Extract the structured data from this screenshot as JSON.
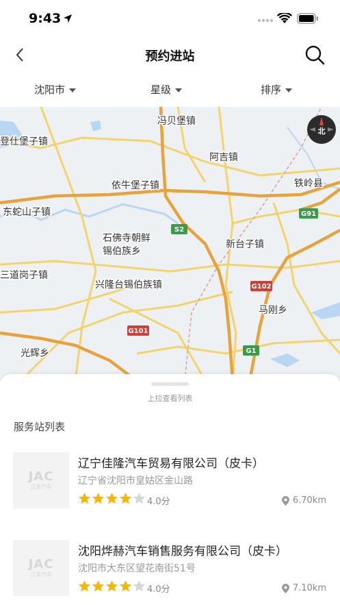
{
  "status_bar": {
    "time": "9:43"
  },
  "nav": {
    "title": "预约进站"
  },
  "filters": [
    {
      "label": "沈阳市"
    },
    {
      "label": "星级"
    },
    {
      "label": "排序"
    }
  ],
  "map": {
    "compass_label": "北",
    "places": [
      "冯贝堡镇",
      "登仕堡子镇",
      "阿吉镇",
      "依牛堡子镇",
      "铁岭县",
      "东蛇山子镇",
      "石佛寺朝鲜",
      "锡伯族乡",
      "新台子镇",
      "三道岗子镇",
      "兴隆台锡伯族镇",
      "马刚乡",
      "光辉乡"
    ],
    "roads": [
      "S2",
      "G91",
      "G102",
      "G101",
      "G1"
    ],
    "colors": {
      "water": "#b9d6f2",
      "expressway": "#e8a23c",
      "road": "#f3d36b",
      "land": "#eef1f4"
    }
  },
  "sheet": {
    "hint": "上拉查看列表",
    "section_title": "服务站列表",
    "stations": [
      {
        "logo_text": "JAC",
        "logo_sub": "江淮汽车",
        "name": "辽宁佳隆汽车贸易有限公司（皮卡）",
        "address": "辽宁省沈阳市皇姑区金山路",
        "rating": 4,
        "rating_max": 5,
        "score_text": "4.0分",
        "distance": "6.70km"
      },
      {
        "logo_text": "JAC",
        "logo_sub": "江淮汽车",
        "name": "沈阳烨赫汽车销售服务有限公司（皮卡）",
        "address": "沈阳市大东区望花南街51号",
        "rating": 4,
        "rating_max": 5,
        "score_text": "4.0分",
        "distance": "7.10km"
      }
    ]
  },
  "colors": {
    "star_filled": "#f5b800",
    "star_empty": "#d6d6d6"
  }
}
